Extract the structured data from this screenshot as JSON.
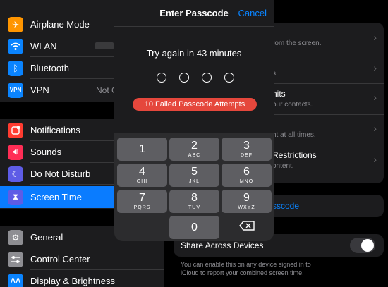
{
  "sidebar": {
    "group1": [
      {
        "label": "Airplane Mode",
        "icon": "airplane-icon",
        "color": "#ff9500",
        "value": ""
      },
      {
        "label": "WLAN",
        "icon": "wifi-icon",
        "color": "#0a84ff",
        "value": ""
      },
      {
        "label": "Bluetooth",
        "icon": "bluetooth-icon",
        "color": "#0a84ff",
        "value": ""
      },
      {
        "label": "VPN",
        "icon": "vpn-icon",
        "color": "#0a84ff",
        "value": "Not C"
      }
    ],
    "group2": [
      {
        "label": "Notifications",
        "icon": "notifications-icon",
        "color": "#ff3b30"
      },
      {
        "label": "Sounds",
        "icon": "sounds-icon",
        "color": "#ff2d55"
      },
      {
        "label": "Do Not Disturb",
        "icon": "moon-icon",
        "color": "#5e5ce6"
      },
      {
        "label": "Screen Time",
        "icon": "hourglass-icon",
        "color": "#5e5ce6",
        "selected": true
      }
    ],
    "group3": [
      {
        "label": "General",
        "icon": "gear-icon",
        "color": "#8e8e93"
      },
      {
        "label": "Control Center",
        "icon": "control-center-icon",
        "color": "#8e8e93"
      },
      {
        "label": "Display & Brightness",
        "icon": "display-icon",
        "color": "#0a84ff"
      }
    ]
  },
  "pane": {
    "row1_sub": "rom the screen.",
    "row2_sub": "s.",
    "row3_title": "nits",
    "row3_sub": "our contacts.",
    "row4_sub": "nt at all times.",
    "row5_title": "Restrictions",
    "row5_sub": "ontent.",
    "passcode_link": "sscode",
    "share_label": "Share Across Devices",
    "share_on": false,
    "footnote": "You can enable this on any device signed in to iCloud to report your combined screen time."
  },
  "modal": {
    "title": "Enter Passcode",
    "cancel": "Cancel",
    "message": "Try again in 43 minutes",
    "failed": "10 Failed Passcode Attempts",
    "dots": 4,
    "keys": [
      {
        "d": "1",
        "l": ""
      },
      {
        "d": "2",
        "l": "ABC"
      },
      {
        "d": "3",
        "l": "DEF"
      },
      {
        "d": "4",
        "l": "GHI"
      },
      {
        "d": "5",
        "l": "JKL"
      },
      {
        "d": "6",
        "l": "MNO"
      },
      {
        "d": "7",
        "l": "PQRS"
      },
      {
        "d": "8",
        "l": "TUV"
      },
      {
        "d": "9",
        "l": "WXYZ"
      },
      {
        "d": "0",
        "l": ""
      }
    ],
    "accent": "#0a84ff",
    "badge_color": "#e5473c"
  }
}
